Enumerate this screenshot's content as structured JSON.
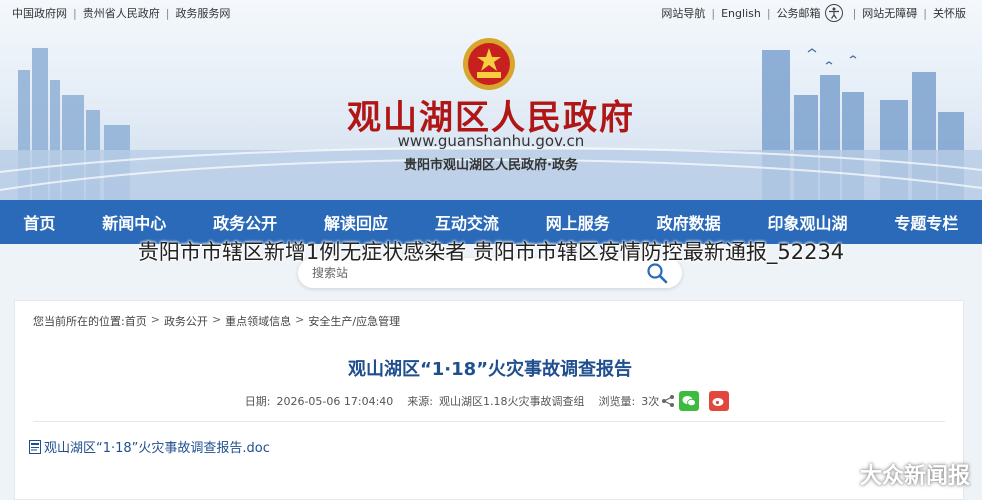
{
  "topbar": {
    "left": [
      "中国政府网",
      "贵州省人民政府",
      "政务服务网"
    ],
    "right": [
      "网站导航",
      "English",
      "公务邮箱",
      "网站无障碍",
      "关怀版"
    ]
  },
  "banner": {
    "title": "观山湖区人民政府",
    "domain": "www.guanshanhu.gov.cn",
    "subtitle": "贵阳市观山湖区人民政府·政务"
  },
  "nav": [
    "首页",
    "新闻中心",
    "政务公开",
    "解读回应",
    "互动交流",
    "网上服务",
    "政府数据",
    "印象观山湖",
    "专题专栏"
  ],
  "overlay_headline": "贵阳市市辖区新增1例无症状感染者  贵阳市市辖区疫情防控最新通报_52234",
  "search": {
    "placeholder": "搜索站"
  },
  "breadcrumb": {
    "prefix": "您当前所在的位置:",
    "items": [
      "首页",
      "政务公开",
      "重点领域信息",
      "安全生产/应急管理"
    ]
  },
  "article": {
    "title": "观山湖区“1·18”火灾事故调查报告",
    "date_label": "日期:",
    "date": "2026-05-06 17:04:40",
    "source_label": "来源:",
    "source": "观山湖区1.18火灾事故调查组",
    "views_label": "浏览量:",
    "views": "3次",
    "attachment": "观山湖区“1·18”火灾事故调查报告.doc"
  },
  "watermark": "大众新闻报",
  "colors": {
    "nav_bg": "#2a6ab8",
    "title_red": "#b01616",
    "link_blue": "#1f4f8f"
  }
}
